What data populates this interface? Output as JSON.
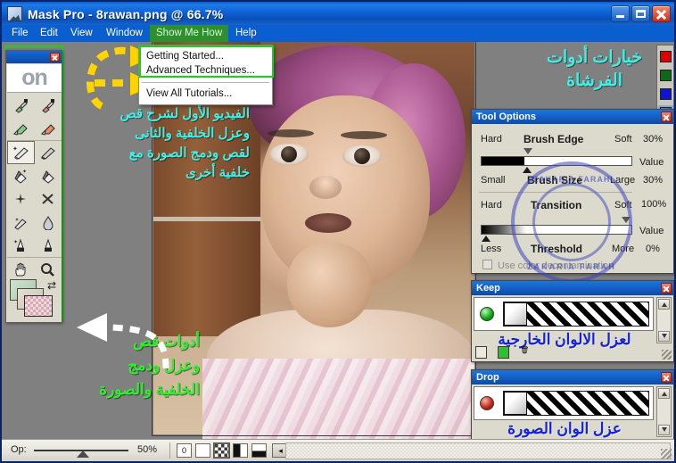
{
  "window": {
    "title": "Mask Pro - 8rawan.png @ 66.7%",
    "app_icon": "image-thumb-icon",
    "buttons": {
      "minimize": "minimize-icon",
      "maximize": "maximize-icon",
      "close": "close-icon"
    }
  },
  "menubar": {
    "items": [
      {
        "label": "File",
        "highlight": false
      },
      {
        "label": "Edit",
        "highlight": false
      },
      {
        "label": "View",
        "highlight": false
      },
      {
        "label": "Window",
        "highlight": false
      },
      {
        "label": "Show Me How",
        "highlight": true
      },
      {
        "label": "Help",
        "highlight": false
      }
    ]
  },
  "dropdown": {
    "items": [
      {
        "label": "Getting Started..."
      },
      {
        "label": "Advanced Techniques..."
      },
      {
        "label": "View All Tutorials..."
      }
    ]
  },
  "toolbar": {
    "logo_on": "on",
    "logo_n": "",
    "close": "close-icon",
    "tools": [
      {
        "name": "eyedropper-keep",
        "glyph": "✒"
      },
      {
        "name": "eyedropper-drop",
        "glyph": "✒"
      },
      {
        "name": "highlighter-keep",
        "glyph": "🖊"
      },
      {
        "name": "highlighter-drop",
        "glyph": "🖊"
      },
      {
        "name": "magic-brush",
        "glyph": "✎",
        "selected": true
      },
      {
        "name": "brush",
        "glyph": "✎"
      },
      {
        "name": "magic-fill",
        "glyph": "◗"
      },
      {
        "name": "paint-bucket",
        "glyph": "◗"
      },
      {
        "name": "magic-wand",
        "glyph": "✳"
      },
      {
        "name": "chisel",
        "glyph": "✂"
      },
      {
        "name": "blur-brush",
        "glyph": "➚"
      },
      {
        "name": "water-drop",
        "glyph": "💧"
      },
      {
        "name": "magic-pen",
        "glyph": "✒"
      },
      {
        "name": "pen",
        "glyph": "✒"
      },
      {
        "name": "hand",
        "glyph": "✋"
      },
      {
        "name": "zoom",
        "glyph": "🔍"
      }
    ],
    "swap_icon": "swap-arrows-icon"
  },
  "tool_options": {
    "title": "Tool Options",
    "close": "close-icon",
    "rows": [
      {
        "left": "Hard",
        "center": "Brush Edge",
        "right": "Soft",
        "value": "30%",
        "unit": "Value"
      },
      {
        "left": "Small",
        "center": "Brush Size",
        "right": "Large",
        "value": "30%",
        "unit": ""
      },
      {
        "left": "Hard",
        "center": "Transition",
        "right": "Soft",
        "value": "100%",
        "unit": "Value"
      },
      {
        "left": "Less",
        "center": "Threshold",
        "right": "More",
        "value": "0%",
        "unit": ""
      }
    ],
    "checkbox_label": "Use color decontamination",
    "checkbox_checked": false,
    "watermark": {
      "top": "ZAKARIA FARAH",
      "bottom": "ZAKARIA FARAH"
    }
  },
  "keep_panel": {
    "title": "Keep",
    "close": "close-icon",
    "led": "green-led-icon",
    "annotation": "لعزل الالوان الخارجية",
    "buttons": [
      "new-color-icon",
      "add-color-icon",
      "trash-icon"
    ]
  },
  "drop_panel": {
    "title": "Drop",
    "close": "close-icon",
    "led": "red-led-icon",
    "annotation": "عزل الوان الصورة",
    "buttons": [
      "new-color-icon",
      "add-color-icon",
      "trash-icon"
    ]
  },
  "color_strip": {
    "swatches": [
      {
        "name": "red-swatch",
        "color": "#e00000",
        "selected": false
      },
      {
        "name": "green-swatch",
        "color": "#0a6b14",
        "selected": false
      },
      {
        "name": "blue-swatch",
        "color": "#0d14d8",
        "selected": false
      },
      {
        "name": "multicolor-swatch",
        "color": "#8a7fa8",
        "selected": true
      }
    ]
  },
  "statusbar": {
    "opacity_label": "Op:",
    "opacity_value": "50%",
    "view_modes": [
      {
        "name": "view-mode-zero",
        "glyph": "0",
        "selected": false
      },
      {
        "name": "view-mode-white",
        "glyph": "",
        "selected": false
      },
      {
        "name": "view-mode-checker",
        "glyph": "",
        "selected": true
      },
      {
        "name": "view-mode-black",
        "glyph": "",
        "selected": false
      },
      {
        "name": "view-mode-split",
        "glyph": "",
        "selected": false
      },
      {
        "name": "view-mode-more",
        "glyph": "◂",
        "selected": false
      }
    ]
  },
  "annotations": {
    "top_right": "خيارات أدوات\nالفرشاة",
    "canvas_text": "الفيديو الأول لشرح قص\nوعزل الخلفية والثانى\nلقص ودمج الصورة مع\nخلفية أخرى",
    "bottom_left": "أدوات قص\nوعزل ودمج\nالخلفية والصورة"
  }
}
